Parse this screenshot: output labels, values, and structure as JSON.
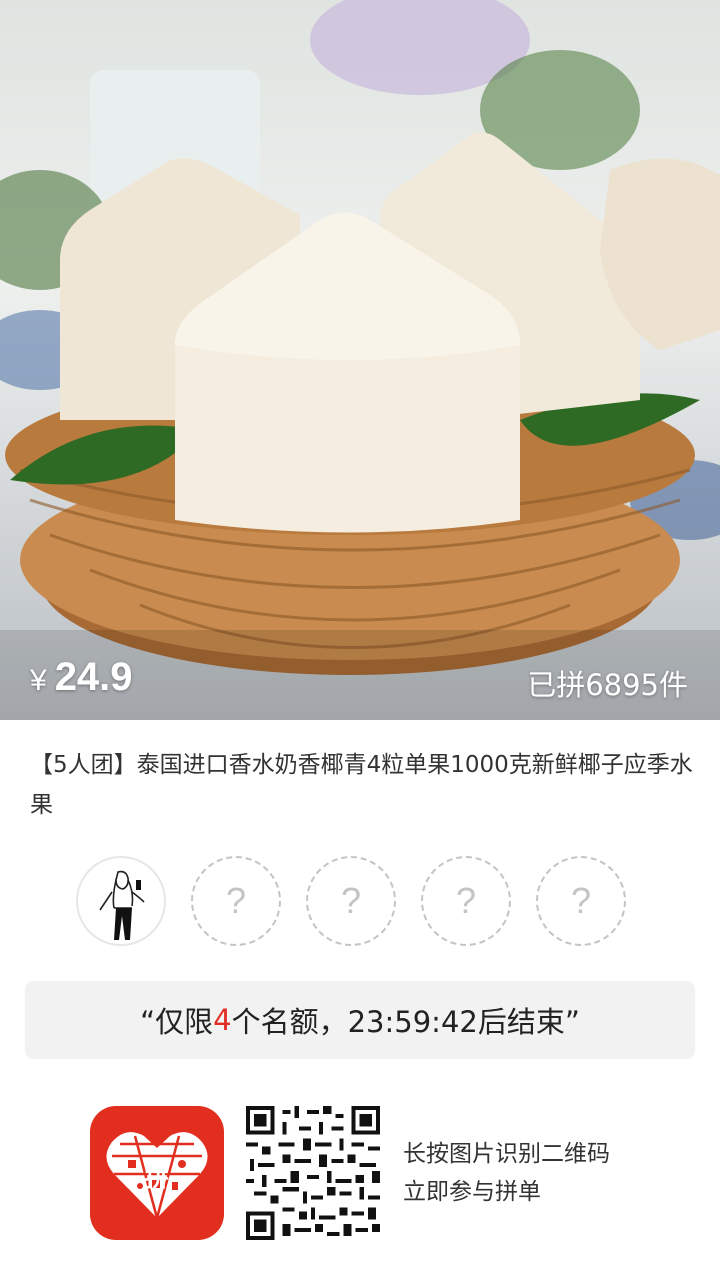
{
  "product": {
    "price_symbol": "¥",
    "price": "24.9",
    "sold_text": "已拼6895件",
    "title": "【5人团】泰国进口香水奶香椰青4粒单果1000克新鲜椰子应季水果"
  },
  "group": {
    "slots": [
      {
        "state": "filled",
        "icon": "user-avatar"
      },
      {
        "state": "empty",
        "label": "?"
      },
      {
        "state": "empty",
        "label": "?"
      },
      {
        "state": "empty",
        "label": "?"
      },
      {
        "state": "empty",
        "label": "?"
      }
    ]
  },
  "notice": {
    "prefix": "“仅限",
    "count": "4",
    "suffix": "个名额，23:59:42后结束”"
  },
  "footer": {
    "logo_char": "拼",
    "scan_line1": "长按图片识别二维码",
    "scan_line2": "立即参与拼单"
  },
  "colors": {
    "accent": "#e02e24",
    "logo_bg": "#e22e1f"
  }
}
